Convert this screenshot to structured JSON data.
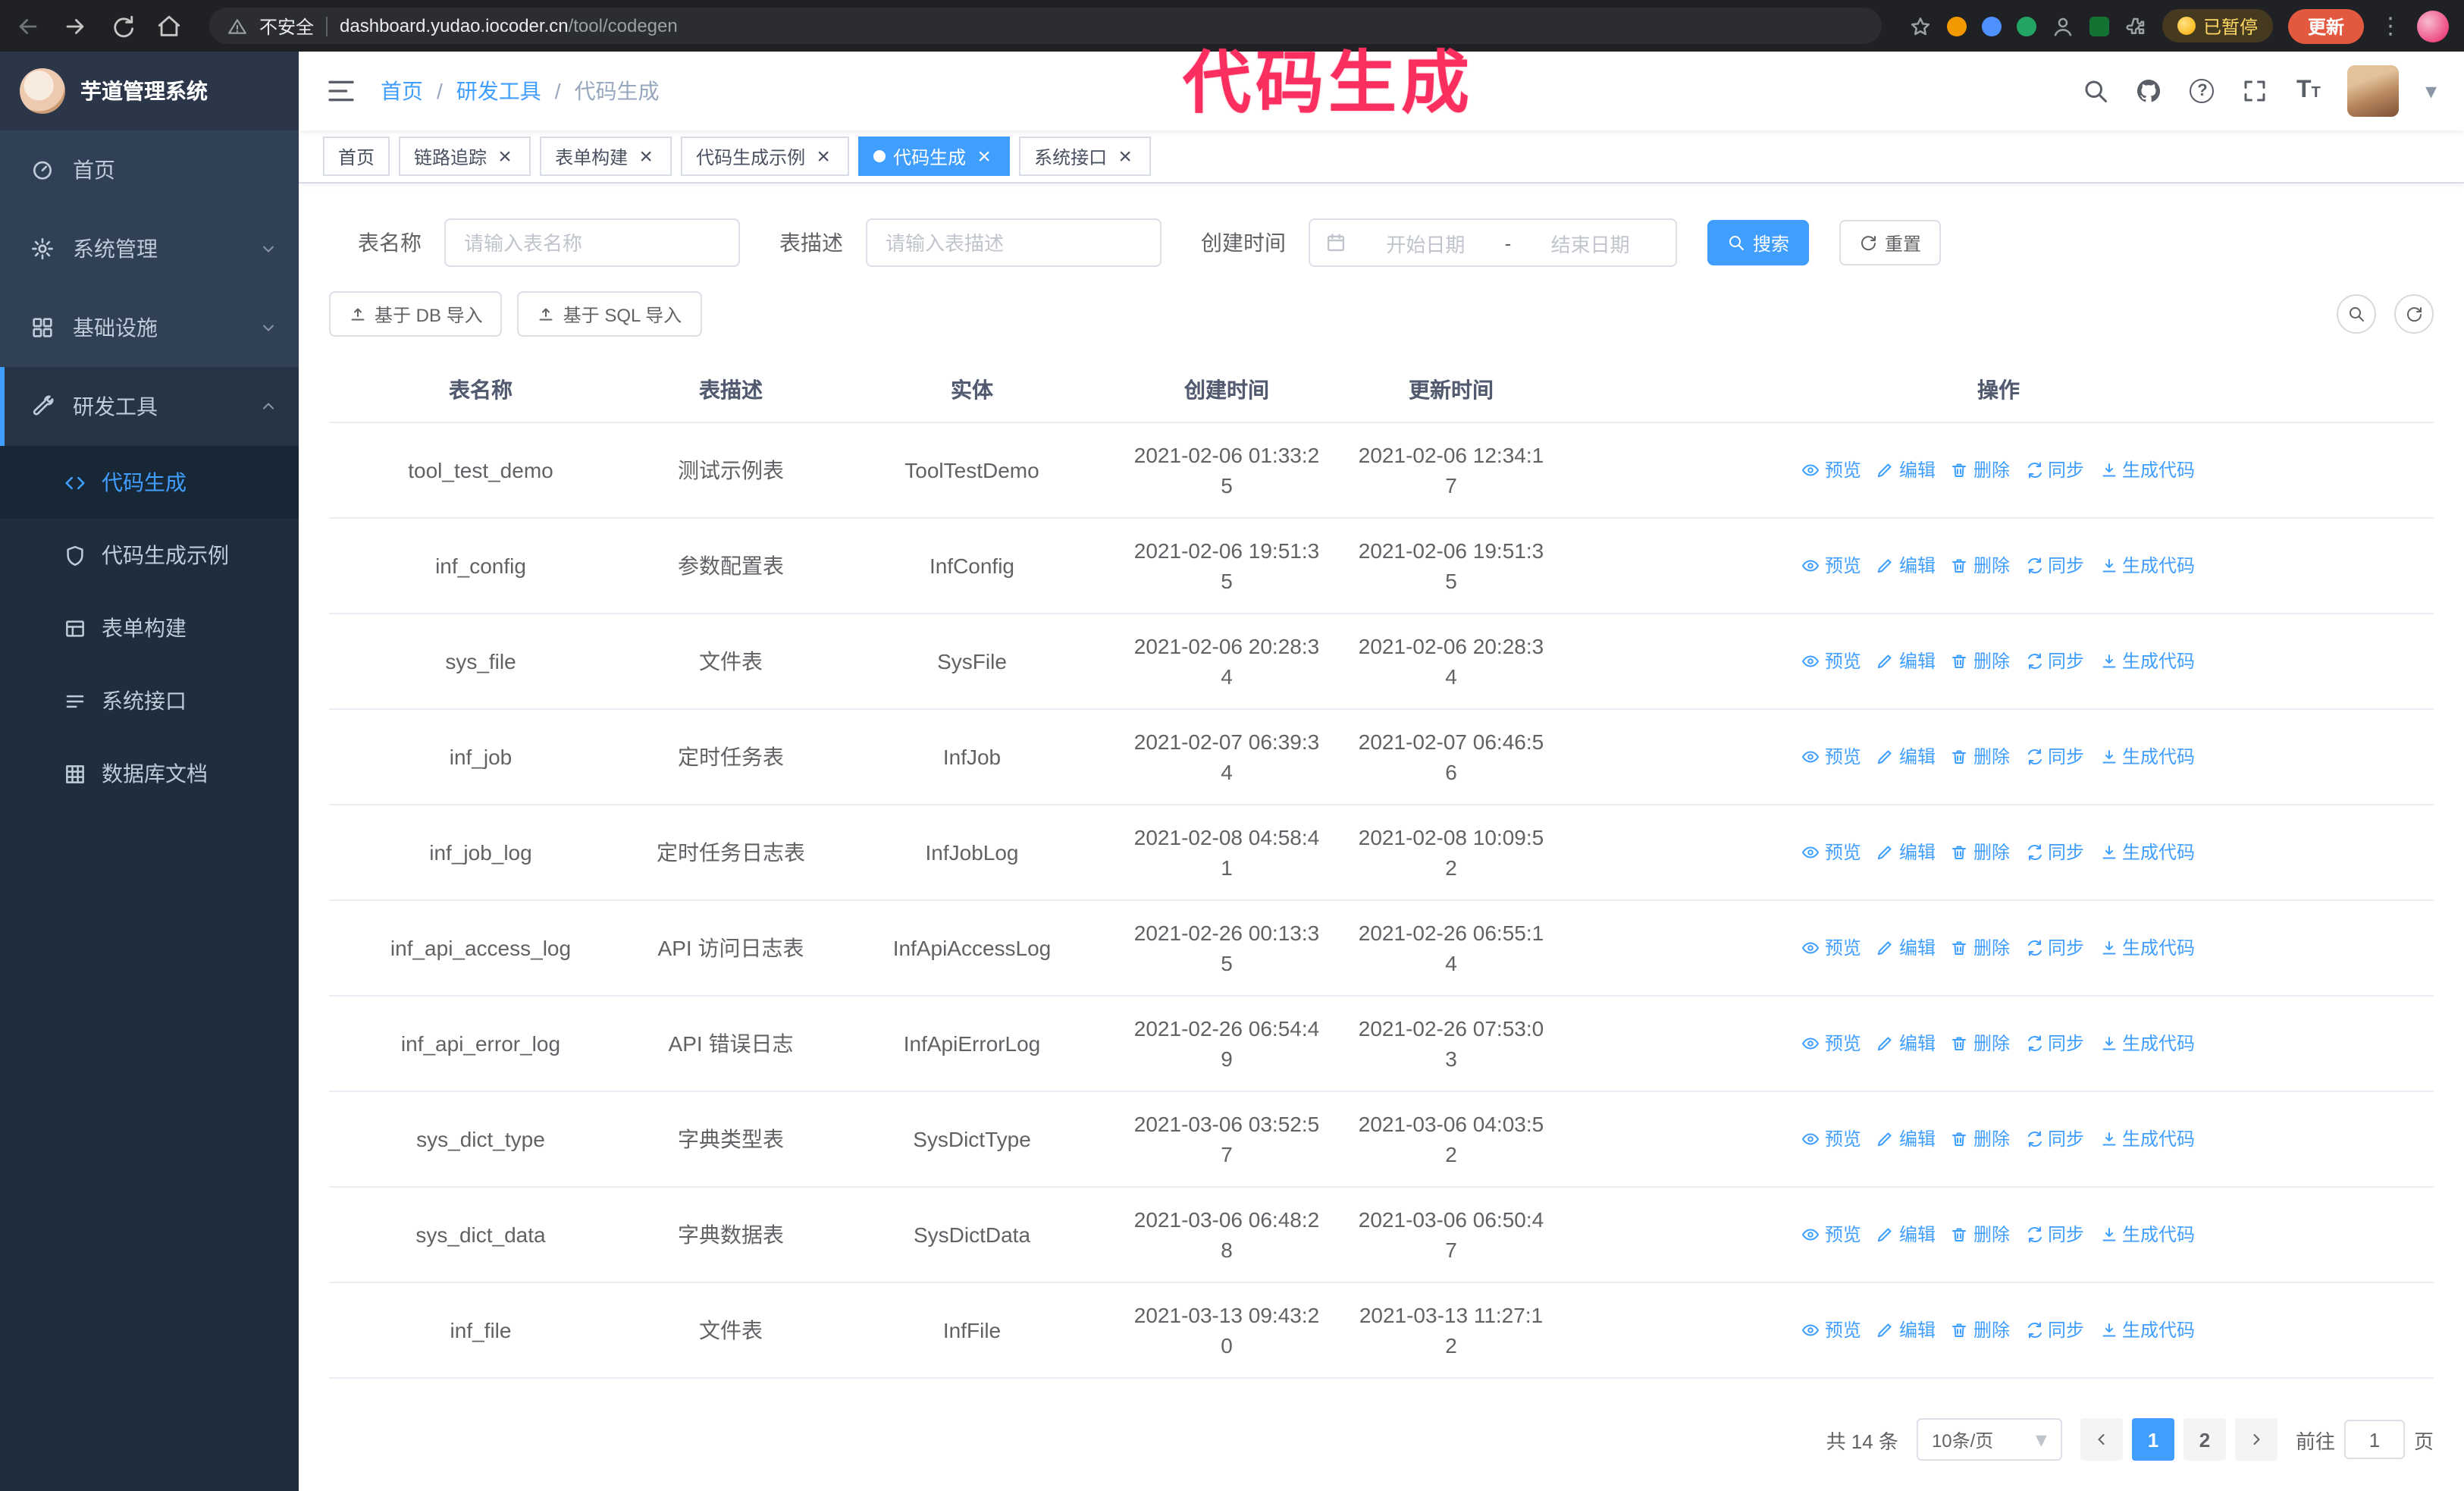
{
  "browser": {
    "security_label": "不安全",
    "url_host": "dashboard.yudao.iocoder.cn",
    "url_path": "/tool/codegen",
    "paused_badge": "已暂停",
    "update_button": "更新"
  },
  "annotation": {
    "text": "代码生成"
  },
  "sidebar": {
    "logo_title": "芋道管理系统",
    "items": [
      {
        "key": "home",
        "label": "首页",
        "icon": "dashboard-icon"
      },
      {
        "key": "system",
        "label": "系统管理",
        "icon": "gear-icon",
        "chevron": "down"
      },
      {
        "key": "infra",
        "label": "基础设施",
        "icon": "components-icon",
        "chevron": "down"
      },
      {
        "key": "devtools",
        "label": "研发工具",
        "icon": "tools-icon",
        "chevron": "up",
        "active": true,
        "children": [
          {
            "key": "codegen",
            "label": "代码生成",
            "icon": "code-icon",
            "active": true
          },
          {
            "key": "codegen-demo",
            "label": "代码生成示例",
            "icon": "shield-icon"
          },
          {
            "key": "form-builder",
            "label": "表单构建",
            "icon": "form-icon"
          },
          {
            "key": "system-api",
            "label": "系统接口",
            "icon": "list-icon"
          },
          {
            "key": "db-doc",
            "label": "数据库文档",
            "icon": "table-grid-icon"
          }
        ]
      }
    ]
  },
  "header": {
    "breadcrumb": [
      "首页",
      "研发工具",
      "代码生成"
    ],
    "separator": "/"
  },
  "tabs": [
    {
      "key": "home",
      "label": "首页",
      "closable": false,
      "active": false
    },
    {
      "key": "tracer",
      "label": "链路追踪",
      "closable": true,
      "active": false
    },
    {
      "key": "form-builder",
      "label": "表单构建",
      "closable": true,
      "active": false
    },
    {
      "key": "codegen-demo",
      "label": "代码生成示例",
      "closable": true,
      "active": false
    },
    {
      "key": "codegen",
      "label": "代码生成",
      "closable": true,
      "active": true
    },
    {
      "key": "system-api",
      "label": "系统接口",
      "closable": true,
      "active": false
    }
  ],
  "filters": {
    "table_name_label": "表名称",
    "table_name_placeholder": "请输入表名称",
    "table_desc_label": "表描述",
    "table_desc_placeholder": "请输入表描述",
    "create_time_label": "创建时间",
    "date_start_placeholder": "开始日期",
    "date_separator": "-",
    "date_end_placeholder": "结束日期",
    "search_label": "搜索",
    "reset_label": "重置"
  },
  "toolbar": {
    "import_db_label": "基于 DB 导入",
    "import_sql_label": "基于 SQL 导入"
  },
  "table": {
    "columns": [
      "表名称",
      "表描述",
      "实体",
      "创建时间",
      "更新时间",
      "操作"
    ],
    "rows": [
      {
        "name": "tool_test_demo",
        "desc": "测试示例表",
        "entity": "ToolTestDemo",
        "created": "2021-02-06 01:33:25",
        "updated": "2021-02-06 12:34:17"
      },
      {
        "name": "inf_config",
        "desc": "参数配置表",
        "entity": "InfConfig",
        "created": "2021-02-06 19:51:35",
        "updated": "2021-02-06 19:51:35"
      },
      {
        "name": "sys_file",
        "desc": "文件表",
        "entity": "SysFile",
        "created": "2021-02-06 20:28:34",
        "updated": "2021-02-06 20:28:34"
      },
      {
        "name": "inf_job",
        "desc": "定时任务表",
        "entity": "InfJob",
        "created": "2021-02-07 06:39:34",
        "updated": "2021-02-07 06:46:56"
      },
      {
        "name": "inf_job_log",
        "desc": "定时任务日志表",
        "entity": "InfJobLog",
        "created": "2021-02-08 04:58:41",
        "updated": "2021-02-08 10:09:52"
      },
      {
        "name": "inf_api_access_log",
        "desc": "API 访问日志表",
        "entity": "InfApiAccessLog",
        "created": "2021-02-26 00:13:35",
        "updated": "2021-02-26 06:55:14"
      },
      {
        "name": "inf_api_error_log",
        "desc": "API 错误日志",
        "entity": "InfApiErrorLog",
        "created": "2021-02-26 06:54:49",
        "updated": "2021-02-26 07:53:03"
      },
      {
        "name": "sys_dict_type",
        "desc": "字典类型表",
        "entity": "SysDictType",
        "created": "2021-03-06 03:52:57",
        "updated": "2021-03-06 04:03:52"
      },
      {
        "name": "sys_dict_data",
        "desc": "字典数据表",
        "entity": "SysDictData",
        "created": "2021-03-06 06:48:28",
        "updated": "2021-03-06 06:50:47"
      },
      {
        "name": "inf_file",
        "desc": "文件表",
        "entity": "InfFile",
        "created": "2021-03-13 09:43:20",
        "updated": "2021-03-13 11:27:12"
      }
    ],
    "row_actions": [
      {
        "key": "preview",
        "label": "预览",
        "icon": "eye-icon"
      },
      {
        "key": "edit",
        "label": "编辑",
        "icon": "edit-icon"
      },
      {
        "key": "delete",
        "label": "删除",
        "icon": "delete-icon"
      },
      {
        "key": "sync",
        "label": "同步",
        "icon": "sync-icon"
      },
      {
        "key": "generate",
        "label": "生成代码",
        "icon": "download-icon"
      }
    ]
  },
  "pagination": {
    "total_label": "共 14 条",
    "page_size": "10条/页",
    "pages": [
      "1",
      "2"
    ],
    "active_page": "1",
    "goto_label": "前往",
    "goto_value": "1",
    "goto_suffix": "页"
  },
  "colors": {
    "accent": "#409EFF",
    "sidebar_bg": "#304156",
    "submenu_bg": "#1F2D3D",
    "annotation": "#FB2F5F",
    "active_tab_bg": "#409EFF",
    "update_button_bg": "#E2593F"
  }
}
